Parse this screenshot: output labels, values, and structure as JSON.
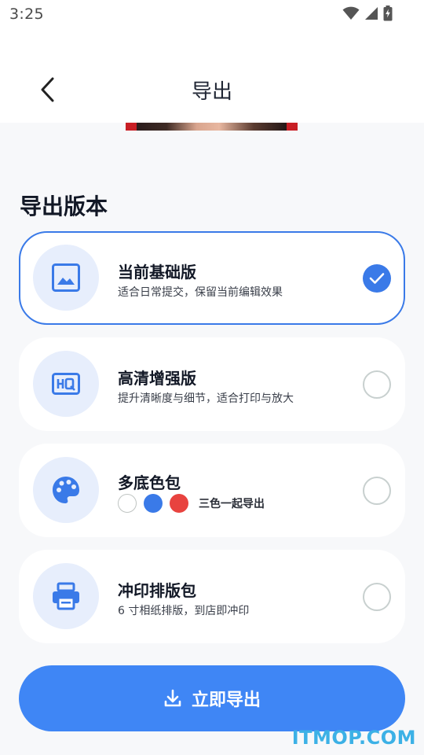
{
  "status_bar": {
    "time": "3:25",
    "icons": [
      "wifi-icon",
      "cellular-signal-icon",
      "battery-charging-icon"
    ]
  },
  "header": {
    "title": "导出",
    "back_icon": "chevron-left-icon"
  },
  "section": {
    "title": "导出版本"
  },
  "options": [
    {
      "title": "当前基础版",
      "description": "适合日常提交，保留当前编辑效果",
      "icon": "image-icon",
      "selected": true
    },
    {
      "title": "高清增强版",
      "description": "提升清晰度与细节，适合打印与放大",
      "icon": "hq-icon",
      "selected": false
    },
    {
      "title": "多底色包",
      "swatches_caption": "三色一起导出",
      "swatches": [
        "#ffffff",
        "#3a7ae8",
        "#e8433f"
      ],
      "icon": "palette-icon",
      "selected": false
    },
    {
      "title": "冲印排版包",
      "description": "6 寸相纸排版，到店即冲印",
      "icon": "printer-icon",
      "selected": false
    }
  ],
  "export_button": {
    "label": "立即导出",
    "icon": "download-icon"
  },
  "watermark": "ITMOP.COM",
  "colors": {
    "accent": "#3a7ae8",
    "button": "#3f86f5",
    "icon_bg": "#e7eefc",
    "page_bg": "#f7f8fa"
  }
}
